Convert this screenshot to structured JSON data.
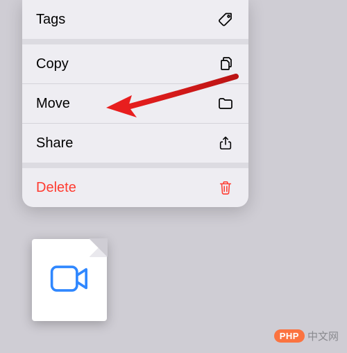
{
  "menu": {
    "items": [
      {
        "label": "Tags",
        "icon": "tag-icon",
        "destructive": false
      },
      {
        "label": "Copy",
        "icon": "copy-icon",
        "destructive": false
      },
      {
        "label": "Move",
        "icon": "folder-icon",
        "destructive": false
      },
      {
        "label": "Share",
        "icon": "share-icon",
        "destructive": false
      },
      {
        "label": "Delete",
        "icon": "trash-icon",
        "destructive": true
      }
    ]
  },
  "file": {
    "type": "video",
    "icon": "video-icon"
  },
  "watermark": {
    "pill": "PHP",
    "text": "中文网"
  },
  "annotation": {
    "arrow_points_to": "Move"
  }
}
